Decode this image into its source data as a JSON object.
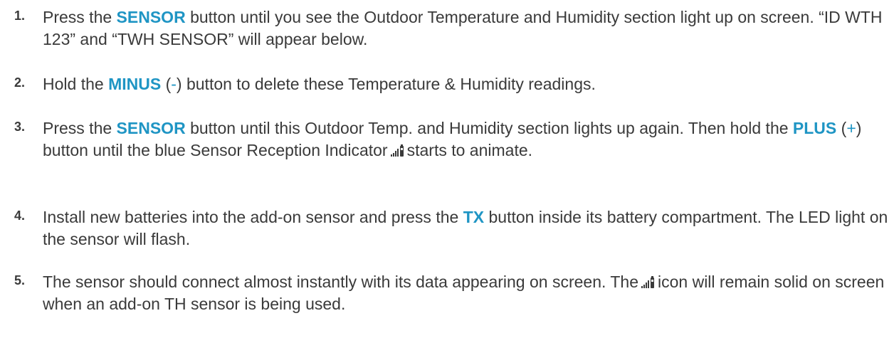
{
  "steps": [
    {
      "number": "1.",
      "parts": {
        "a": "Press the ",
        "b": "SENSOR",
        "c": " button until you see the Outdoor Temperature and Humidity section light up on screen. “ID WTH 123” and “TWH SENSOR” will appear below."
      }
    },
    {
      "number": "2.",
      "parts": {
        "a": "Hold the ",
        "b": "MINUS",
        "c": " (",
        "d": "-",
        "e": ") button to delete these Temperature & Humidity readings."
      }
    },
    {
      "number": "3.",
      "parts": {
        "a": "Press the ",
        "b": "SENSOR",
        "c": " button until this Outdoor Temp. and Humidity section lights up again. Then hold the ",
        "d": "PLUS",
        "e": " (",
        "f": "+",
        "g": ") button until the blue Sensor Reception Indicator",
        "h": "starts to animate."
      }
    },
    {
      "number": "4.",
      "parts": {
        "a": "Install new batteries into the add-on sensor and press the ",
        "b": "TX",
        "c": " button inside its battery compartment. The LED light on the sensor will flash."
      }
    },
    {
      "number": "5.",
      "parts": {
        "a": "The sensor should connect almost instantly with its data appearing on screen. The",
        "b": "icon will remain solid on screen when an add-on TH sensor is being used."
      }
    }
  ],
  "icons": {
    "reception_indicator": "signal-bars-battery-icon"
  },
  "colors": {
    "text": "#3a3a3a",
    "accent": "#1f95c4"
  }
}
